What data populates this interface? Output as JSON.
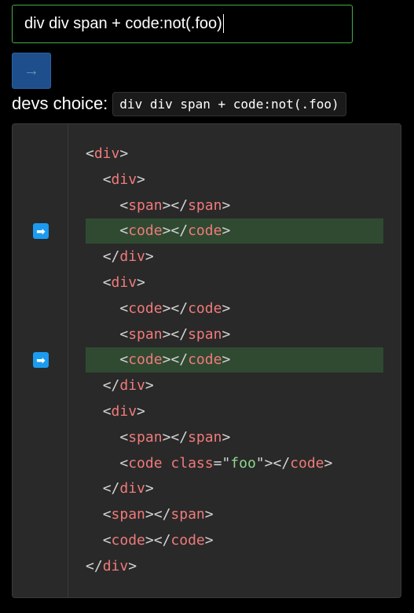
{
  "input": {
    "value": "div div span + code:not(.foo)"
  },
  "submit": {
    "icon": "arrow-right-icon",
    "glyph": "→"
  },
  "choice": {
    "label": "devs choice:",
    "code": "div div span + code:not(.foo)"
  },
  "markup_lines": [
    {
      "indent": "",
      "text": "<div>",
      "match": false
    },
    {
      "indent": "  ",
      "text": "<div>",
      "match": false
    },
    {
      "indent": "    ",
      "text": "<span></span>",
      "match": false
    },
    {
      "indent": "    ",
      "text": "<code></code>",
      "match": true
    },
    {
      "indent": "  ",
      "text": "</div>",
      "match": false
    },
    {
      "indent": "  ",
      "text": "<div>",
      "match": false
    },
    {
      "indent": "    ",
      "text": "<code></code>",
      "match": false
    },
    {
      "indent": "    ",
      "text": "<span></span>",
      "match": false
    },
    {
      "indent": "    ",
      "text": "<code></code>",
      "match": true
    },
    {
      "indent": "  ",
      "text": "</div>",
      "match": false
    },
    {
      "indent": "  ",
      "text": "<div>",
      "match": false
    },
    {
      "indent": "    ",
      "text": "<span></span>",
      "match": false
    },
    {
      "indent": "    ",
      "text": "<code class=\"foo\"></code>",
      "match": false
    },
    {
      "indent": "  ",
      "text": "</div>",
      "match": false
    },
    {
      "indent": "  ",
      "text": "<span></span>",
      "match": false
    },
    {
      "indent": "  ",
      "text": "<code></code>",
      "match": false
    },
    {
      "indent": "",
      "text": "</div>",
      "match": false
    }
  ],
  "marker": {
    "icon": "arrow-right-icon",
    "glyph": "➡"
  },
  "colors": {
    "tag": "#f07a7a",
    "punct": "#d4d4d4",
    "string": "#8fd68f",
    "match_bg": "#304a32",
    "marker_bg": "#1b9bf0",
    "input_border": "#3fae4a",
    "button_bg": "#1e4f8c"
  }
}
